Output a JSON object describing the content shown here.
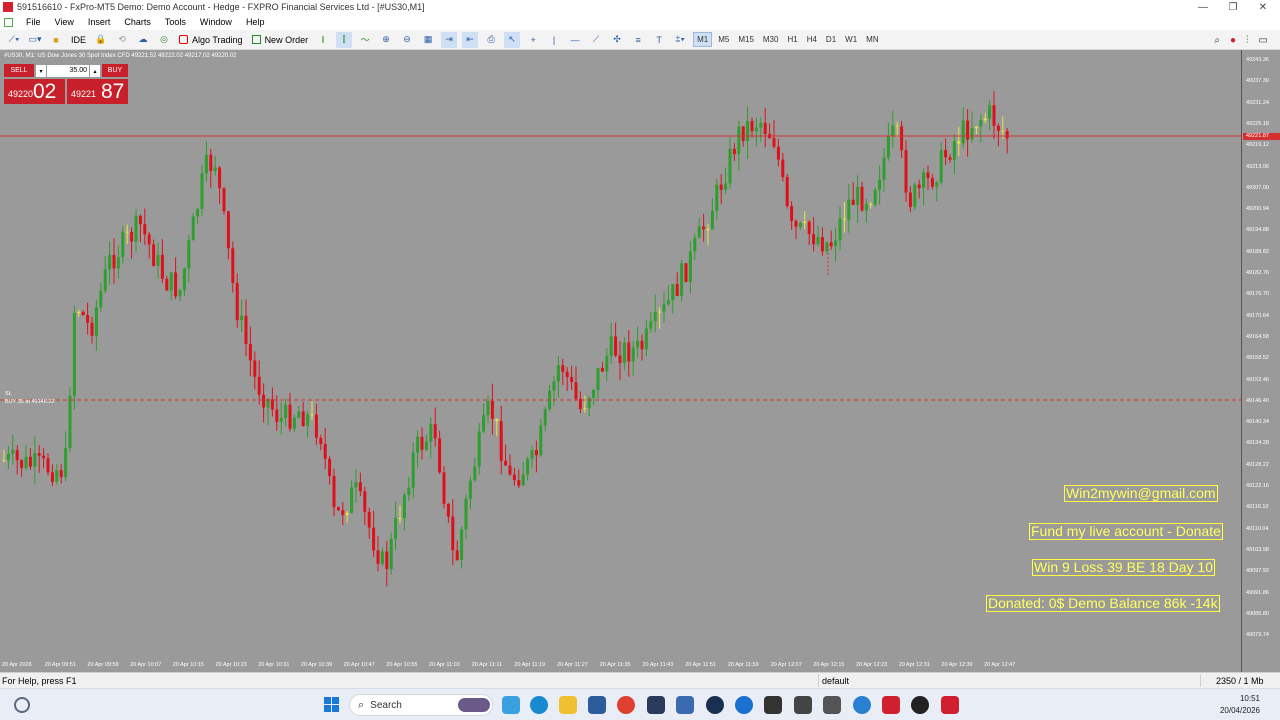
{
  "window": {
    "title": "591516610 - FxPro-MT5 Demo: Demo Account - Hedge - FXPRO Financial Services Ltd - [#US30,M1]",
    "controls": [
      "—",
      "❐",
      "✕"
    ]
  },
  "menu": [
    "File",
    "View",
    "Insert",
    "Charts",
    "Tools",
    "Window",
    "Help"
  ],
  "toolbar": {
    "ide_label": "IDE",
    "algo_trading_label": "Algo Trading",
    "new_order_label": "New Order",
    "timeframes": [
      "M1",
      "M5",
      "M15",
      "M30",
      "H1",
      "H4",
      "D1",
      "W1",
      "MN"
    ],
    "active_timeframe": "M1"
  },
  "chart": {
    "symbol_info": "#US30, M1: US Dow Jones 30 Spot Index CFD  49221.52 49222.02 49217.02 49220.02",
    "trade_panel": {
      "sell_label": "SELL",
      "buy_label": "BUY",
      "lot": "35.00",
      "sell_small": "49220",
      "sell_big": "02",
      "buy_small": "49221",
      "buy_big": "87"
    },
    "sl_label": "SL",
    "buy_position_label": "BUY 35 at 49146.22",
    "current_price": "49221.87",
    "price_labels": [
      "49243.36",
      "49237.30",
      "49231.24",
      "49225.18",
      "49219.12",
      "49213.06",
      "49207.00",
      "49200.94",
      "49194.88",
      "49188.82",
      "49182.76",
      "49176.70",
      "49170.64",
      "49164.58",
      "49158.52",
      "49152.46",
      "49146.40",
      "49140.34",
      "49134.28",
      "49128.22",
      "49122.16",
      "49116.10",
      "49110.04",
      "49103.98",
      "49097.92",
      "49091.86",
      "49085.80",
      "49079.74"
    ],
    "time_labels": [
      "20 Apr 2026",
      "20 Apr 09:51",
      "20 Apr 09:59",
      "20 Apr 10:07",
      "20 Apr 10:15",
      "20 Apr 10:23",
      "20 Apr 10:31",
      "20 Apr 10:39",
      "20 Apr 10:47",
      "20 Apr 10:55",
      "20 Apr 11:03",
      "20 Apr 11:11",
      "20 Apr 11:19",
      "20 Apr 11:27",
      "20 Apr 11:35",
      "20 Apr 11:43",
      "20 Apr 11:51",
      "20 Apr 11:59",
      "20 Apr 12:07",
      "20 Apr 12:15",
      "20 Apr 12:23",
      "20 Apr 12:31",
      "20 Apr 12:39",
      "20 Apr 12:47"
    ],
    "info_boxes": [
      "Win2mywin@gmail.com",
      "Fund my live account - Donate",
      "Win 9  Loss 39  BE 18  Day 10",
      "Donated: 0$  Demo Balance 86k -14k"
    ],
    "colors": {
      "background": "#9a9a9a",
      "bull": "#2e9e2e",
      "bear": "#e0101a",
      "doji": "#e6e640",
      "price_line": "#d43030"
    }
  },
  "status": {
    "help": "For Help, press F1",
    "profile": "default",
    "connection": "2350 / 1 Mb"
  },
  "taskbar": {
    "search_placeholder": "Search",
    "time": "10:51",
    "date": "20/04/2026"
  }
}
